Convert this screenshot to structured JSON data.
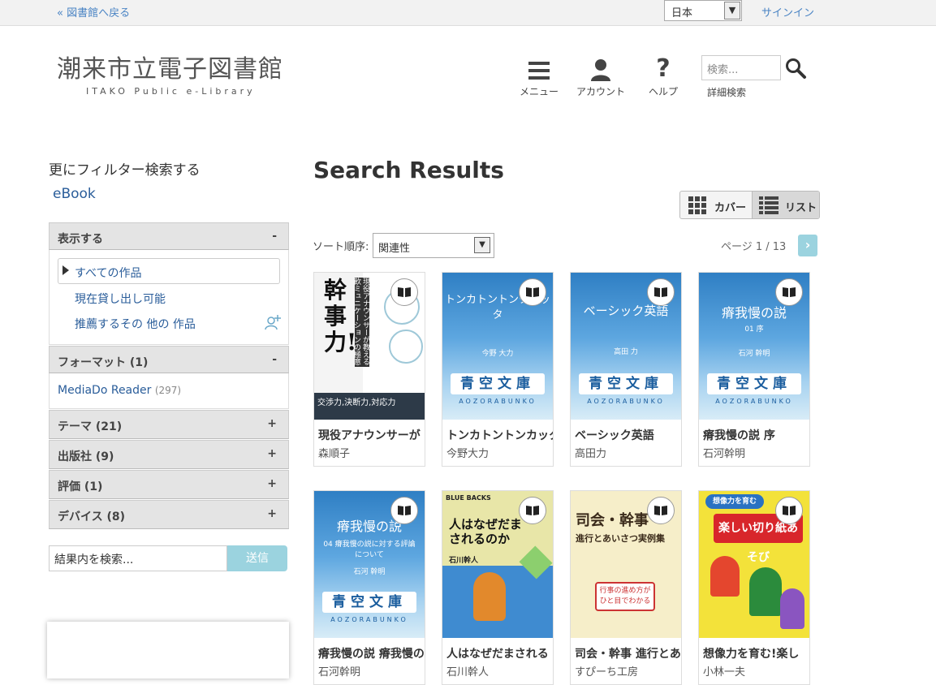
{
  "topbar": {
    "back_link": "« 図書館へ戻る",
    "language": "日本",
    "signin": "サインイン"
  },
  "logo": {
    "title": "潮来市立電子図書館",
    "subtitle": "ITAKO Public e-Library"
  },
  "nav": {
    "menu": "メニュー",
    "account": "アカウント",
    "help": "ヘルプ",
    "search_placeholder": "検索...",
    "advanced_search": "詳細検索"
  },
  "sidebar": {
    "heading": "更にフィルター検索する",
    "ebook": "eBook",
    "show_section": {
      "title": "表示する",
      "toggle": "-",
      "show_all": "すべての作品",
      "available": "現在貸し出し可能",
      "recommend": "推薦するその 他の 作品"
    },
    "format_section": {
      "title": "フォーマット (1)",
      "toggle": "-",
      "item": "MediaDo Reader",
      "item_count": "(297)"
    },
    "collapsed": [
      {
        "title": "テーマ (21)",
        "toggle": "+"
      },
      {
        "title": "出版社 (9)",
        "toggle": "+"
      },
      {
        "title": "評価 (1)",
        "toggle": "+"
      },
      {
        "title": "デバイス (8)",
        "toggle": "+"
      }
    ],
    "result_search": {
      "value": "結果内を検索...",
      "button": "送信"
    }
  },
  "results": {
    "title": "Search Results",
    "view": {
      "cover": "カバー",
      "list": "リスト",
      "active": "list"
    },
    "sort_label": "ソート順序:",
    "sort_value": "関連性",
    "page_info": "ページ 1 / 13",
    "page_next": "›"
  },
  "books": [
    {
      "title": "現役アナウンサーが",
      "author": "森順子",
      "cover_title": "幹事力!",
      "cover_sub": "現役アナウンサーが教える飲ミュニケーションの極意",
      "cover_tagline": "交渉力,決断力,対応力"
    },
    {
      "title": "トンカトントンカッタカ",
      "author": "今野大力",
      "cover_title": "トンカトントンタカッタ",
      "cover_author": "今野 大力",
      "bunko": "青空文庫",
      "roma": "AOZORABUNKO"
    },
    {
      "title": "ベーシック英語",
      "author": "高田力",
      "cover_title": "ベーシック英語",
      "cover_author": "高田 力",
      "bunko": "青空文庫",
      "roma": "AOZORABUNKO"
    },
    {
      "title": "瘠我慢の説 序",
      "author": "石河幹明",
      "cover_title": "瘠我慢の説",
      "cover_sub": "01 序",
      "cover_author": "石河 幹明",
      "bunko": "青空文庫",
      "roma": "AOZORABUNKO"
    },
    {
      "title": "瘠我慢の説 瘠我慢の",
      "author": "石河幹明",
      "cover_title": "瘠我慢の説",
      "cover_sub": "04 瘠我慢の説に対する評論について",
      "cover_author": "石河 幹明",
      "bunko": "青空文庫",
      "roma": "AOZORABUNKO"
    },
    {
      "title": "人はなぜだまされる",
      "author": "石川幹人",
      "cover_title": "人はなぜだまされるのか",
      "cover_series": "BLUE BACKS",
      "cover_author": "石川幹人"
    },
    {
      "title": "司会・幹事 進行とあ",
      "author": "すぴーち工房",
      "cover_title": "司会・幹事",
      "cover_sub": "進行とあいさつ実例集",
      "cover_note": "行事の進め方がひと目でわかる"
    },
    {
      "title": "想像力を育む!楽し",
      "author": "小林一夫",
      "cover_title": "楽しい切り紙あそび",
      "cover_top": "想像力を育む"
    }
  ],
  "colors": {
    "accent": "#9bd3df",
    "link": "#2a5d9a",
    "aozora_blue": "#2f7fc4"
  }
}
